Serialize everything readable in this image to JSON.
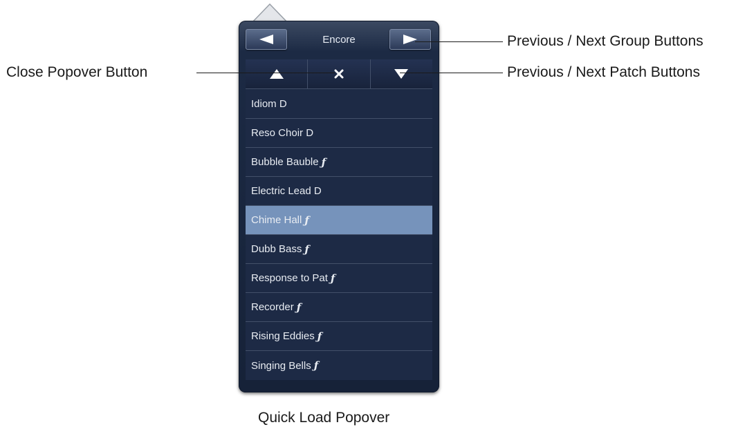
{
  "annotations": {
    "group_buttons": "Previous / Next Group Buttons",
    "close_button": "Close Popover Button",
    "patch_buttons": "Previous / Next Patch Buttons",
    "caption": "Quick Load Popover"
  },
  "popover": {
    "group_title": "Encore",
    "icons": {
      "prev_group": "left-triangle-icon",
      "next_group": "right-triangle-icon",
      "prev_patch": "up-triangle-icon",
      "close": "close-x-icon",
      "next_patch": "down-triangle-icon"
    },
    "patches": [
      {
        "name": "Idiom D",
        "flag": ""
      },
      {
        "name": "Reso Choir D",
        "flag": ""
      },
      {
        "name": "Bubble Bauble",
        "flag": "ƒ"
      },
      {
        "name": "Electric Lead D",
        "flag": ""
      },
      {
        "name": "Chime Hall",
        "flag": "ƒ"
      },
      {
        "name": "Dubb Bass",
        "flag": "ƒ"
      },
      {
        "name": "Response to Pat",
        "flag": "ƒ"
      },
      {
        "name": "Recorder",
        "flag": "ƒ"
      },
      {
        "name": "Rising Eddies",
        "flag": "ƒ"
      },
      {
        "name": "Singing Bells",
        "flag": "ƒ"
      }
    ],
    "selected_index": 4
  },
  "colors": {
    "panel": "#1d2a45",
    "selected_row": "#7693bb",
    "text": "#e8ecf2"
  }
}
